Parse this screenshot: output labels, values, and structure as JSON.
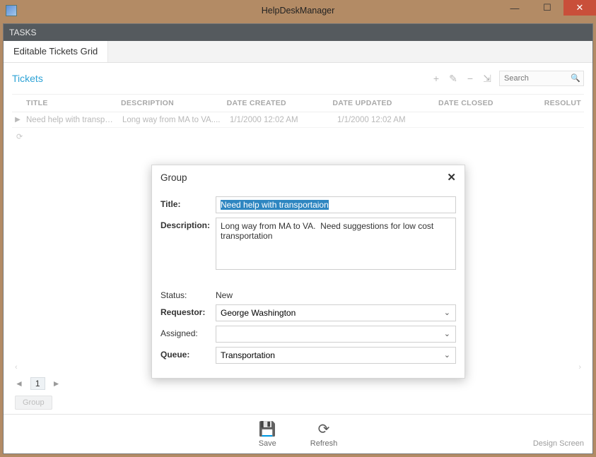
{
  "app": {
    "title": "HelpDeskManager"
  },
  "window_controls": {
    "min": "—",
    "max": "☐",
    "close": "✕"
  },
  "tasks_bar": {
    "label": "TASKS"
  },
  "tabs": [
    {
      "label": "Editable Tickets Grid"
    }
  ],
  "section": {
    "title": "Tickets"
  },
  "toolbar": {
    "add": "+",
    "edit": "✎",
    "remove": "−",
    "export": "⇲",
    "search_placeholder": "Search"
  },
  "grid": {
    "columns": {
      "title": "TITLE",
      "description": "DESCRIPTION",
      "date_created": "DATE CREATED",
      "date_updated": "DATE UPDATED",
      "date_closed": "DATE CLOSED",
      "resolution": "RESOLUT"
    },
    "rows": [
      {
        "title": "Need help with transportaion",
        "description": "Long way from MA to VA....",
        "date_created": "1/1/2000 12:02 AM",
        "date_updated": "1/1/2000 12:02 AM",
        "date_closed": "",
        "resolution": ""
      }
    ]
  },
  "pager": {
    "prev": "◄",
    "page": "1",
    "next": "►"
  },
  "group_button": {
    "label": "Group"
  },
  "bottombar": {
    "save": "Save",
    "refresh": "Refresh",
    "design": "Design Screen"
  },
  "popup": {
    "heading": "Group",
    "labels": {
      "title": "Title:",
      "description": "Description:",
      "status": "Status:",
      "requestor": "Requestor:",
      "assigned": "Assigned:",
      "queue": "Queue:"
    },
    "values": {
      "title": "Need help with transportaion",
      "description": "Long way from MA to VA.  Need suggestions for low cost transportation",
      "status": "New",
      "requestor": "George Washington",
      "assigned": "",
      "queue": "Transportation"
    }
  }
}
